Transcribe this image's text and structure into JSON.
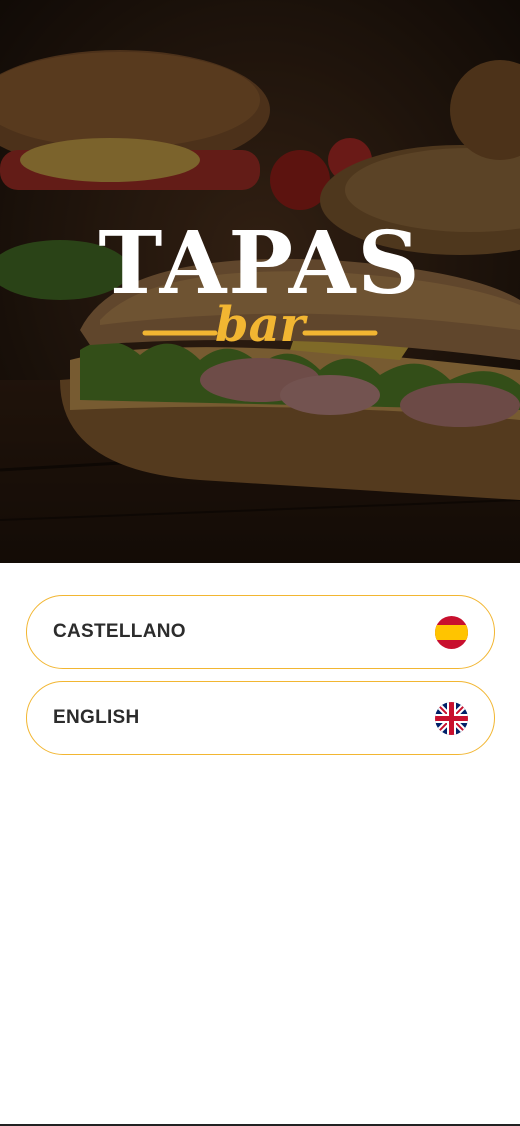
{
  "brand": {
    "name_main": "TAPAS",
    "name_sub": "bar",
    "accent_color": "#f2b632",
    "logo_color": "#ffffff"
  },
  "hero": {
    "image_desc_icon": "sandwich-photo"
  },
  "languages": [
    {
      "label": "CASTELLANO",
      "flag_icon": "spain-flag-icon"
    },
    {
      "label": "ENGLISH",
      "flag_icon": "uk-flag-icon"
    }
  ]
}
